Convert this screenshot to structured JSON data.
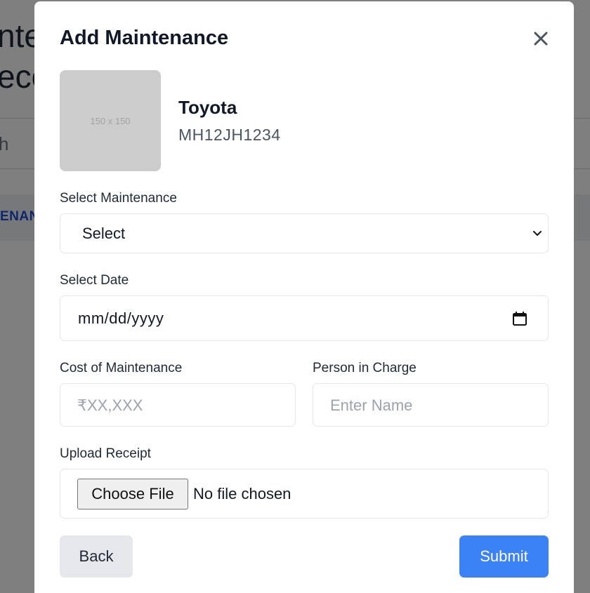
{
  "background": {
    "title_line1": "nte",
    "title_line2": "eco",
    "search_text": "h",
    "tab_text": "ENAN"
  },
  "modal": {
    "title": "Add Maintenance",
    "close_icon": "close-icon"
  },
  "vehicle": {
    "image_placeholder": "150 x 150",
    "name": "Toyota",
    "plate": "MH12JH1234"
  },
  "form": {
    "maintenance_label": "Select Maintenance",
    "maintenance_value": "Select",
    "date_label": "Select Date",
    "date_value": "mm/dd/yyyy",
    "cost_label": "Cost of Maintenance",
    "cost_placeholder": "₹XX,XXX",
    "person_label": "Person in Charge",
    "person_placeholder": "Enter Name",
    "receipt_label": "Upload Receipt",
    "choose_file_label": "Choose File",
    "file_status": "No file chosen"
  },
  "actions": {
    "back_label": "Back",
    "submit_label": "Submit"
  },
  "colors": {
    "primary": "#3b82f6",
    "secondary_button": "#e5e7eb",
    "overlay": "rgba(0,0,0,0.5)"
  }
}
